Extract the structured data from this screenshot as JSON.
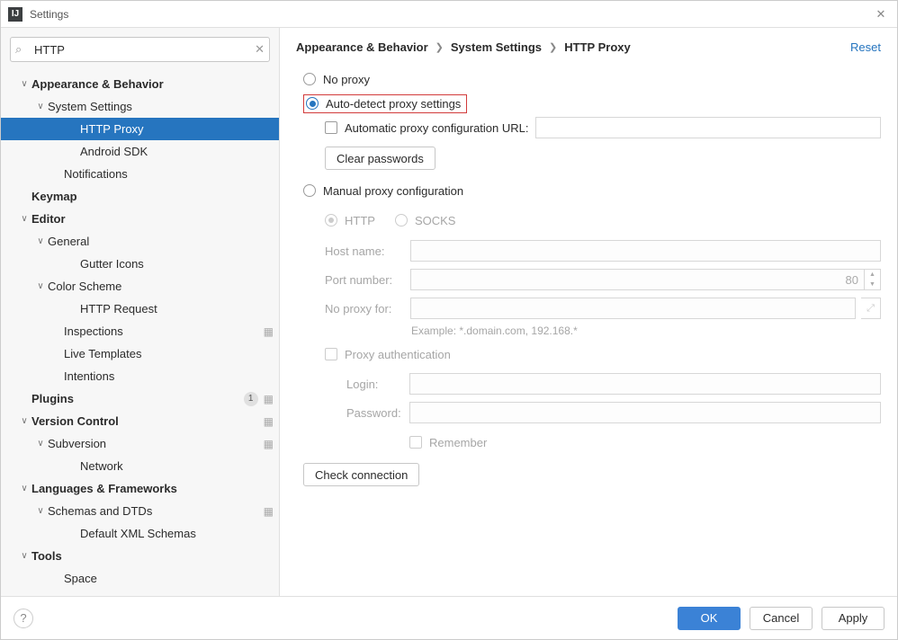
{
  "window": {
    "title": "Settings",
    "app_icon": "IJ"
  },
  "search": {
    "value": "HTTP",
    "placeholder": ""
  },
  "tree": [
    {
      "label": "Appearance & Behavior",
      "indent": 1,
      "bold": true,
      "chev": "∨"
    },
    {
      "label": "System Settings",
      "indent": 2,
      "chev": "∨"
    },
    {
      "label": "HTTP Proxy",
      "indent": 4,
      "selected": true
    },
    {
      "label": "Android SDK",
      "indent": 4
    },
    {
      "label": "Notifications",
      "indent": 3
    },
    {
      "label": "Keymap",
      "indent": 1,
      "bold": true
    },
    {
      "label": "Editor",
      "indent": 1,
      "bold": true,
      "chev": "∨"
    },
    {
      "label": "General",
      "indent": 2,
      "chev": "∨"
    },
    {
      "label": "Gutter Icons",
      "indent": 4
    },
    {
      "label": "Color Scheme",
      "indent": 2,
      "chev": "∨"
    },
    {
      "label": "HTTP Request",
      "indent": 4
    },
    {
      "label": "Inspections",
      "indent": 3,
      "gear": true
    },
    {
      "label": "Live Templates",
      "indent": 3
    },
    {
      "label": "Intentions",
      "indent": 3
    },
    {
      "label": "Plugins",
      "indent": 1,
      "bold": true,
      "badge": "1",
      "gear": true
    },
    {
      "label": "Version Control",
      "indent": 1,
      "bold": true,
      "chev": "∨",
      "gear": true
    },
    {
      "label": "Subversion",
      "indent": 2,
      "chev": "∨",
      "gear": true
    },
    {
      "label": "Network",
      "indent": 4
    },
    {
      "label": "Languages & Frameworks",
      "indent": 1,
      "bold": true,
      "chev": "∨"
    },
    {
      "label": "Schemas and DTDs",
      "indent": 2,
      "chev": "∨",
      "gear": true
    },
    {
      "label": "Default XML Schemas",
      "indent": 4
    },
    {
      "label": "Tools",
      "indent": 1,
      "bold": true,
      "chev": "∨"
    },
    {
      "label": "Space",
      "indent": 3
    }
  ],
  "breadcrumb": {
    "a": "Appearance & Behavior",
    "b": "System Settings",
    "c": "HTTP Proxy"
  },
  "reset": "Reset",
  "proxy": {
    "no_proxy": "No proxy",
    "auto_detect": "Auto-detect proxy settings",
    "auto_url_label": "Automatic proxy configuration URL:",
    "auto_url_value": "",
    "clear_passwords": "Clear passwords",
    "manual": "Manual proxy configuration",
    "http": "HTTP",
    "socks": "SOCKS",
    "host_label": "Host name:",
    "host_value": "",
    "port_label": "Port number:",
    "port_value": "80",
    "no_proxy_for_label": "No proxy for:",
    "no_proxy_for_value": "",
    "example": "Example: *.domain.com, 192.168.*",
    "proxy_auth": "Proxy authentication",
    "login_label": "Login:",
    "login_value": "",
    "password_label": "Password:",
    "password_value": "",
    "remember": "Remember",
    "check_connection": "Check connection"
  },
  "footer": {
    "help": "?",
    "ok": "OK",
    "cancel": "Cancel",
    "apply": "Apply"
  }
}
